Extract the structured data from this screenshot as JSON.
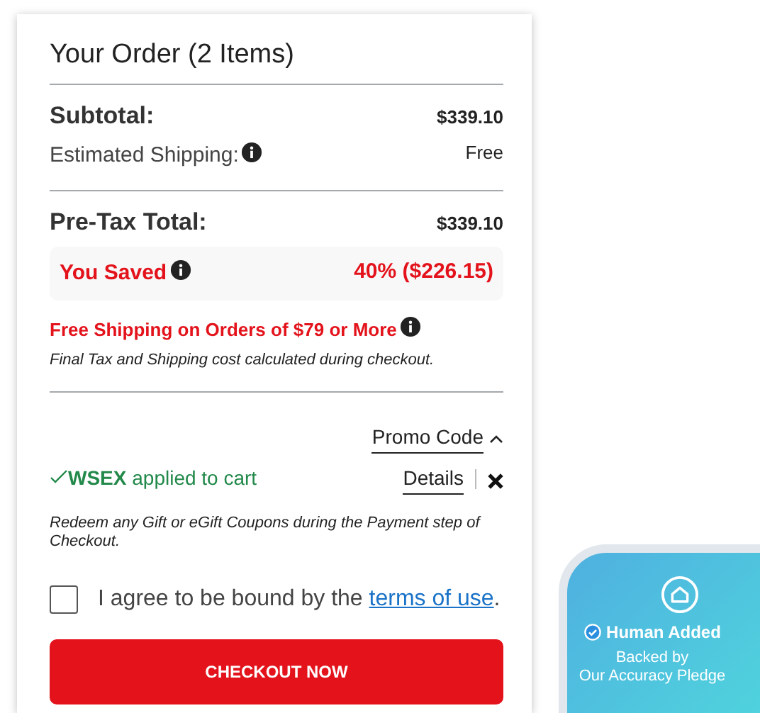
{
  "order": {
    "title": "Your Order (2 Items)",
    "subtotal": {
      "label": "Subtotal:",
      "value": "$339.10"
    },
    "shipping": {
      "label": "Estimated Shipping:",
      "value": "Free"
    },
    "pretax": {
      "label": "Pre-Tax Total:",
      "value": "$339.10"
    },
    "saved": {
      "label": "You Saved",
      "value": "40% ($226.15)"
    },
    "free_shipping_note": "Free Shipping on Orders of $79 or More",
    "tax_note": "Final Tax and Shipping cost calculated during checkout.",
    "promo": {
      "label": "Promo Code",
      "expanded": true,
      "applied_text": "**WSEX** applied to cart",
      "details_link": "Details"
    },
    "gift_note": "Redeem any Gift or eGift Coupons during the Payment step of Checkout.",
    "agree": {
      "checked": false,
      "text": "I agree to be bound by the ",
      "link": "terms of use",
      "suffix": "."
    },
    "checkout_button": "CHECKOUT NOW"
  },
  "badge": {
    "title": "Human Added",
    "subtitle_lines": [
      "Backed by",
      "Our Accuracy Pledge"
    ]
  }
}
